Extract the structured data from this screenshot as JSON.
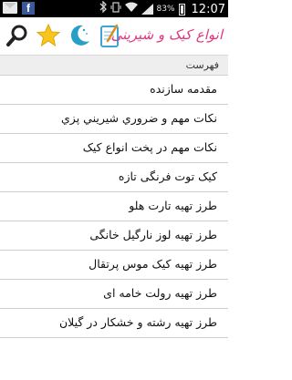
{
  "status_bar": {
    "battery_percent": "83%",
    "time": "12:07",
    "icons": [
      "mail-icon",
      "facebook-icon",
      "bluetooth-icon",
      "vibrate-icon",
      "wifi-icon",
      "signal-icon",
      "battery-icon"
    ],
    "facebook_glyph": "f"
  },
  "app": {
    "title": "انواع کیک و شیرینی",
    "toolbar_icons": [
      "search-icon",
      "star-icon",
      "moon-icon",
      "notepad-icon"
    ]
  },
  "section": {
    "title": "فهرست"
  },
  "list": {
    "items": [
      {
        "label": "مقدمه سازنده"
      },
      {
        "label": "نکات مهم و ضروري شيريني پزي"
      },
      {
        "label": "نکات مهم در پخت انواع کيک"
      },
      {
        "label": "کیک توت فرنگی تازه"
      },
      {
        "label": "طرز تهيه تارت هلو"
      },
      {
        "label": "طرز تهیه لوز نارگیل خانگی"
      },
      {
        "label": "طرز تهیه کیک موس پرتقال"
      },
      {
        "label": "طرز تهيه رولت خامه ای"
      },
      {
        "label": "طرز تهيه رشته و خشکار در گیلان"
      }
    ]
  },
  "colors": {
    "title_pink": "#e0357f",
    "search_icon": "#222222",
    "star_yellow": "#f7c51e",
    "moon_teal": "#2a9fc6",
    "notepad": "#3da3d8"
  }
}
